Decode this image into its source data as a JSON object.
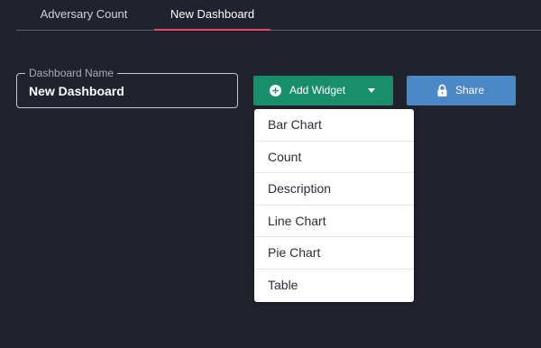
{
  "tabs": [
    {
      "label": "Adversary Count",
      "active": false
    },
    {
      "label": "New Dashboard",
      "active": true
    }
  ],
  "dashboard_name": {
    "label": "Dashboard Name",
    "value": "New Dashboard"
  },
  "add_widget": {
    "label": "Add Widget",
    "icon": "plus-circle-icon",
    "caret_icon": "caret-down-icon",
    "color": "#178f6a"
  },
  "share": {
    "label": "Share",
    "icon": "lock-icon",
    "color": "#4a88c7"
  },
  "widget_menu": {
    "items": [
      "Bar Chart",
      "Count",
      "Description",
      "Line Chart",
      "Pie Chart",
      "Table"
    ]
  },
  "colors": {
    "background": "#20232d",
    "active_tab_underline": "#e5486b"
  }
}
